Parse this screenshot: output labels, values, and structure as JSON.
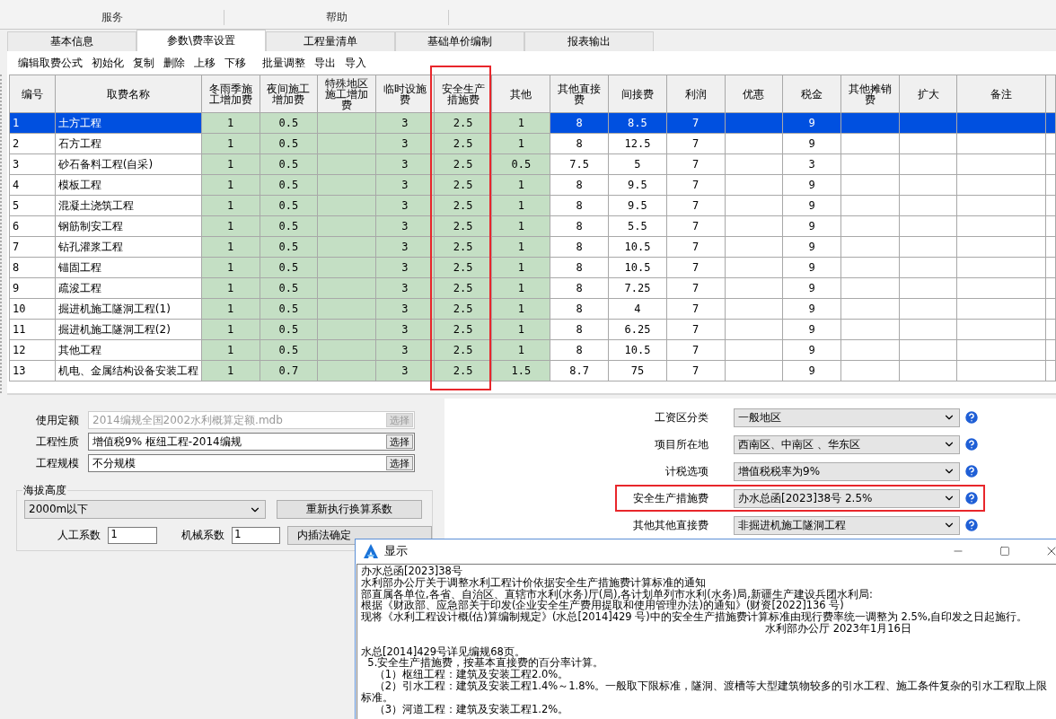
{
  "menu": [
    {
      "label": "服务"
    },
    {
      "label": "帮助"
    }
  ],
  "tabs": [
    {
      "label": "基本信息",
      "selected": false
    },
    {
      "label": "参数\\费率设置",
      "selected": true
    },
    {
      "label": "工程量清单",
      "selected": false
    },
    {
      "label": "基础单价编制",
      "selected": false
    },
    {
      "label": "报表输出",
      "selected": false
    }
  ],
  "toolbar": [
    "编辑取费公式",
    "初始化",
    "复制",
    "删除",
    "上移",
    "下移",
    "批量调整",
    "导出",
    "导入"
  ],
  "fee_table": {
    "columns": [
      {
        "label": "编号",
        "kind": "index",
        "shaded": false,
        "highlighted": false
      },
      {
        "label": "取费名称",
        "kind": "text",
        "shaded": false,
        "highlighted": false
      },
      {
        "label": "冬雨季施工增加费",
        "kind": "number",
        "shaded": true,
        "highlighted": false
      },
      {
        "label": "夜间施工增加费",
        "kind": "number",
        "shaded": true,
        "highlighted": false
      },
      {
        "label": "特殊地区施工增加费",
        "kind": "number",
        "shaded": true,
        "highlighted": false
      },
      {
        "label": "临时设施费",
        "kind": "number",
        "shaded": true,
        "highlighted": false
      },
      {
        "label": "安全生产措施费",
        "kind": "number",
        "shaded": true,
        "highlighted": true
      },
      {
        "label": "其他",
        "kind": "number",
        "shaded": true,
        "highlighted": false
      },
      {
        "label": "其他直接费",
        "kind": "number",
        "shaded": false,
        "highlighted": false
      },
      {
        "label": "间接费",
        "kind": "number",
        "shaded": false,
        "highlighted": false
      },
      {
        "label": "利润",
        "kind": "number",
        "shaded": false,
        "highlighted": false
      },
      {
        "label": "优惠",
        "kind": "number",
        "shaded": false,
        "highlighted": false
      },
      {
        "label": "税金",
        "kind": "number",
        "shaded": false,
        "highlighted": false
      },
      {
        "label": "其他摊销费",
        "kind": "number",
        "shaded": false,
        "highlighted": false
      },
      {
        "label": "扩大",
        "kind": "number",
        "shaded": false,
        "highlighted": false
      },
      {
        "label": "备注",
        "kind": "text",
        "shaded": false,
        "highlighted": false
      }
    ],
    "rows": [
      {
        "selected": true,
        "cells": [
          "1",
          "土方工程",
          "1",
          "0.5",
          null,
          "3",
          "2.5",
          "1",
          "8",
          "8.5",
          "7",
          null,
          "9",
          null,
          null,
          null
        ]
      },
      {
        "selected": false,
        "cells": [
          "2",
          "石方工程",
          "1",
          "0.5",
          null,
          "3",
          "2.5",
          "1",
          "8",
          "12.5",
          "7",
          null,
          "9",
          null,
          null,
          null
        ]
      },
      {
        "selected": false,
        "cells": [
          "3",
          "砂石备料工程(自采)",
          "1",
          "0.5",
          null,
          "3",
          "2.5",
          "0.5",
          "7.5",
          "5",
          "7",
          null,
          "3",
          null,
          null,
          null
        ]
      },
      {
        "selected": false,
        "cells": [
          "4",
          "模板工程",
          "1",
          "0.5",
          null,
          "3",
          "2.5",
          "1",
          "8",
          "9.5",
          "7",
          null,
          "9",
          null,
          null,
          null
        ]
      },
      {
        "selected": false,
        "cells": [
          "5",
          "混凝土浇筑工程",
          "1",
          "0.5",
          null,
          "3",
          "2.5",
          "1",
          "8",
          "9.5",
          "7",
          null,
          "9",
          null,
          null,
          null
        ]
      },
      {
        "selected": false,
        "cells": [
          "6",
          "钢筋制安工程",
          "1",
          "0.5",
          null,
          "3",
          "2.5",
          "1",
          "8",
          "5.5",
          "7",
          null,
          "9",
          null,
          null,
          null
        ]
      },
      {
        "selected": false,
        "cells": [
          "7",
          "钻孔灌浆工程",
          "1",
          "0.5",
          null,
          "3",
          "2.5",
          "1",
          "8",
          "10.5",
          "7",
          null,
          "9",
          null,
          null,
          null
        ]
      },
      {
        "selected": false,
        "cells": [
          "8",
          "锚固工程",
          "1",
          "0.5",
          null,
          "3",
          "2.5",
          "1",
          "8",
          "10.5",
          "7",
          null,
          "9",
          null,
          null,
          null
        ]
      },
      {
        "selected": false,
        "cells": [
          "9",
          "疏浚工程",
          "1",
          "0.5",
          null,
          "3",
          "2.5",
          "1",
          "8",
          "7.25",
          "7",
          null,
          "9",
          null,
          null,
          null
        ]
      },
      {
        "selected": false,
        "cells": [
          "10",
          "掘进机施工隧洞工程(1)",
          "1",
          "0.5",
          null,
          "3",
          "2.5",
          "1",
          "8",
          "4",
          "7",
          null,
          "9",
          null,
          null,
          null
        ]
      },
      {
        "selected": false,
        "cells": [
          "11",
          "掘进机施工隧洞工程(2)",
          "1",
          "0.5",
          null,
          "3",
          "2.5",
          "1",
          "8",
          "6.25",
          "7",
          null,
          "9",
          null,
          null,
          null
        ]
      },
      {
        "selected": false,
        "cells": [
          "12",
          "其他工程",
          "1",
          "0.5",
          null,
          "3",
          "2.5",
          "1",
          "8",
          "10.5",
          "7",
          null,
          "9",
          null,
          null,
          null
        ]
      },
      {
        "selected": false,
        "cells": [
          "13",
          "机电、金属结构设备安装工程",
          "1",
          "0.7",
          null,
          "3",
          "2.5",
          "1.5",
          "8.7",
          "75",
          "7",
          null,
          "9",
          null,
          null,
          null
        ]
      }
    ]
  },
  "project_fields": [
    {
      "label": "使用定额",
      "value": "2014编规全国2002水利概算定额.mdb",
      "button": "选择",
      "disabled": true
    },
    {
      "label": "工程性质",
      "value": "增值税9%  枢纽工程-2014编规",
      "button": "选择",
      "disabled": false
    },
    {
      "label": "工程规模",
      "value": "不分规模",
      "button": "选择",
      "disabled": false
    }
  ],
  "altitude": {
    "title": "海拔高度",
    "value": "2000m以下",
    "recalc_button": "重新执行换算系数",
    "labor_label": "人工系数",
    "labor_value": "1",
    "machine_label": "机械系数",
    "machine_value": "1",
    "interp_button": "内插法确定"
  },
  "options": [
    {
      "label": "工资区分类",
      "value": "一般地区",
      "highlighted": false
    },
    {
      "label": "项目所在地",
      "value": "西南区、中南区 、华东区",
      "highlighted": false
    },
    {
      "label": "计税选项",
      "value": "增值税税率为9%",
      "highlighted": false
    },
    {
      "label": "安全生产措施费",
      "value": "办水总函[2023]38号 2.5%",
      "highlighted": true
    },
    {
      "label": "其他其他直接费",
      "value": "非掘进机施工隧洞工程",
      "highlighted": false
    }
  ],
  "dialog": {
    "title": "显示",
    "lines": [
      {
        "kind": "line",
        "text": "办水总函[2023]38号"
      },
      {
        "kind": "line",
        "text": "水利部办公厅关于调整水利工程计价依据安全生产措施费计算标准的通知"
      },
      {
        "kind": "line",
        "text": "部直属各单位,各省、自治区、直辖市水利(水务)厅(局),各计划单列市水利(水务)局,新疆生产建设兵团水利局:"
      },
      {
        "kind": "line",
        "text": "根据《财政部、应急部关于印发(企业安全生产费用提取和使用管理办法)的通知》(财资[2022]136 号)"
      },
      {
        "kind": "line",
        "text": "现将《水利工程设计概(估)算编制规定》(水总[2014]429 号)中的安全生产措施费计算标准由现行费率统一调整为 2.5%,自印发之日起施行。"
      },
      {
        "kind": "signature",
        "text": "水利部办公厅 2023年1月16日"
      },
      {
        "kind": "gap"
      },
      {
        "kind": "line",
        "text": "水总[2014]429号详见编规68页。"
      },
      {
        "kind": "line",
        "text": "  5.安全生产措施费，按基本直接费的百分率计算。"
      },
      {
        "kind": "line",
        "text": "    （1）枢纽工程：建筑及安装工程2.0%。"
      },
      {
        "kind": "line",
        "text": "    （2）引水工程：建筑及安装工程1.4%～1.8%。一般取下限标准，隧洞、渡槽等大型建筑物较多的引水工程、施工条件复杂的引水工程取上限标准。"
      },
      {
        "kind": "line",
        "text": "    （3）河道工程：建筑及安装工程1.2%。"
      }
    ]
  }
}
